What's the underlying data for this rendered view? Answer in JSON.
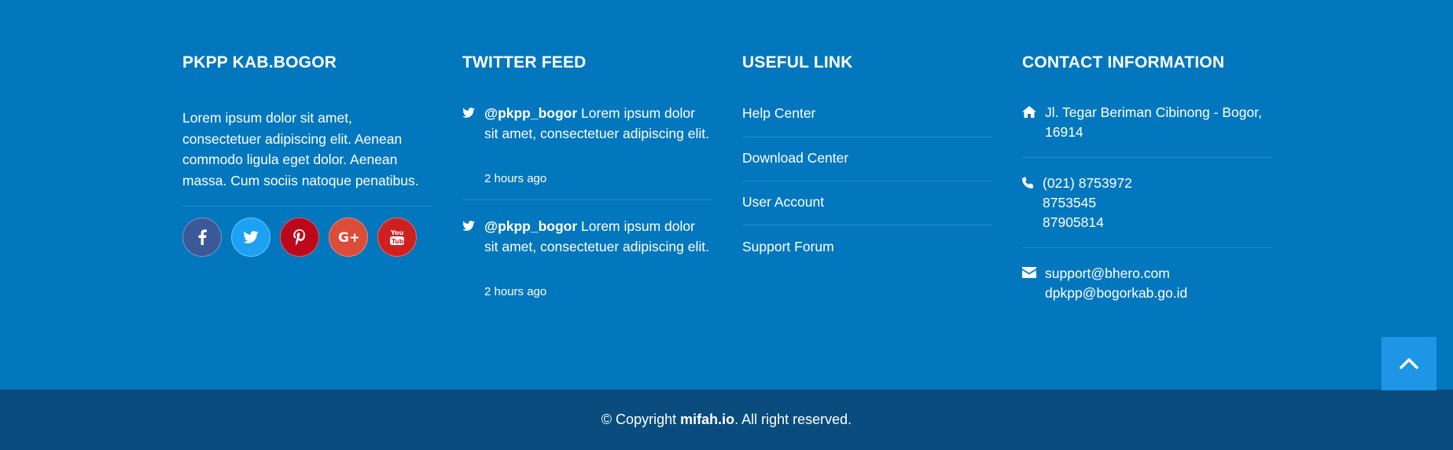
{
  "about": {
    "title": "PKPP KAB.BOGOR",
    "text": "Lorem ipsum dolor sit amet, consectetuer adipiscing elit. Aenean commodo ligula eget dolor. Aenean massa. Cum sociis natoque penatibus.",
    "social": [
      {
        "name": "facebook-icon",
        "color": "#3b5998"
      },
      {
        "name": "twitter-icon",
        "color": "#1da1f2"
      },
      {
        "name": "pinterest-icon",
        "color": "#bd081c"
      },
      {
        "name": "google-plus-icon",
        "color": "#dd4b39"
      },
      {
        "name": "youtube-icon",
        "color": "#cd201f"
      }
    ]
  },
  "twitter": {
    "title": "TWITTER FEED",
    "tweets": [
      {
        "handle": "@pkpp_bogor",
        "text": " Lorem ipsum dolor sit amet, consectetuer adipiscing elit.",
        "time": "2 hours ago"
      },
      {
        "handle": "@pkpp_bogor",
        "text": " Lorem ipsum dolor sit amet, consectetuer adipiscing elit.",
        "time": "2 hours ago"
      }
    ]
  },
  "links": {
    "title": "USEFUL LINK",
    "items": [
      "Help Center",
      "Download Center",
      "User Account",
      "Support Forum"
    ]
  },
  "contact": {
    "title": "CONTACT INFORMATION",
    "address": [
      "Jl. Tegar Beriman Cibinong - Bogor,",
      "16914"
    ],
    "phones": [
      "(021) 8753972",
      "8753545",
      "87905814"
    ],
    "emails": [
      "support@bhero.com",
      "dpkpp@bogorkab.go.id"
    ]
  },
  "back_to_top_icon": "chevron-up-icon",
  "copyright": {
    "prefix": "© Copyright ",
    "brand": "mifah.io",
    "suffix": ". All right reserved."
  },
  "colors": {
    "footer_bg": "#0277bd",
    "bottom_bar_bg": "#0a4c7e",
    "back_to_top_bg": "#1e96e6"
  }
}
